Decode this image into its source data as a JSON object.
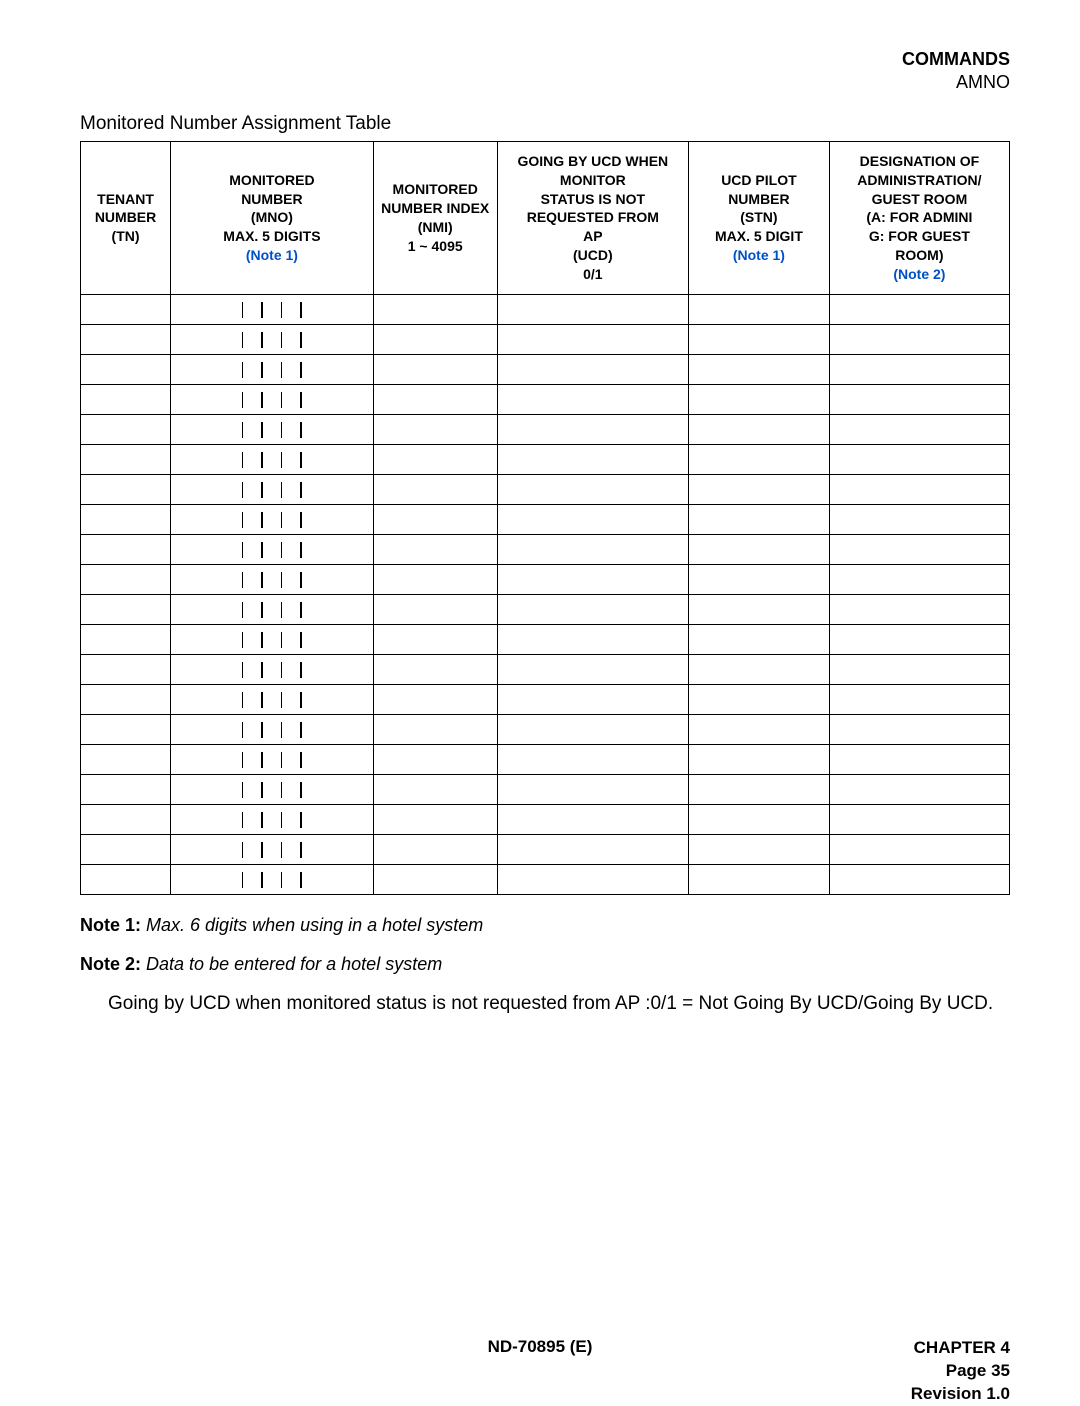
{
  "header": {
    "commands": "COMMANDS",
    "amno": "AMNO"
  },
  "title": "Monitored Number Assignment Table",
  "columns": {
    "tn": {
      "l1": "TENANT",
      "l2": "NUMBER",
      "l3": "(TN)"
    },
    "mno": {
      "l1": "MONITORED",
      "l2": "NUMBER",
      "l3": "(MNO)",
      "l4": "MAX. 5 DIGITS",
      "note": "(Note 1)"
    },
    "nmi": {
      "l1": "MONITORED",
      "l2": "NUMBER INDEX",
      "l3": "(NMI)",
      "l4": "1 ~ 4095"
    },
    "ucd": {
      "l1": "GOING BY UCD WHEN",
      "l2": "MONITOR",
      "l3": "STATUS IS NOT",
      "l4": "REQUESTED FROM",
      "l5": "AP",
      "l6": "(UCD)",
      "l7": "0/1"
    },
    "stn": {
      "l1": "UCD PILOT",
      "l2": "NUMBER",
      "l3": "(STN)",
      "l4": "MAX. 5 DIGIT",
      "note": "(Note 1)"
    },
    "dag": {
      "l1": "DESIGNATION OF",
      "l2": "ADMINISTRATION/",
      "l3": "GUEST ROOM",
      "l4": "(A: FOR ADMINI",
      "l5": "G: FOR GUEST",
      "l6": "ROOM)",
      "note": "(Note 2)"
    }
  },
  "row_count": 20,
  "notes": {
    "n1_label": "Note 1:",
    "n1_text": "Max. 6 digits when using in a hotel system",
    "n2_label": "Note 2:",
    "n2_text": "Data to be entered for a hotel system"
  },
  "going_text": "Going by UCD when monitored status is not requested from AP  :0/1 = Not Going By UCD/Going By UCD.",
  "footer": {
    "doc": "ND-70895 (E)",
    "chapter": "CHAPTER 4",
    "page": "Page 35",
    "rev": "Revision 1.0"
  }
}
